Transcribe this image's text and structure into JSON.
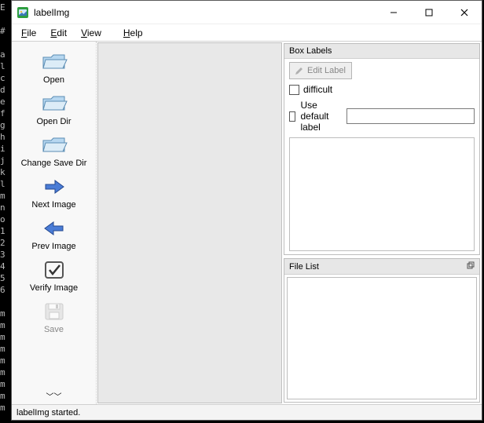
{
  "window": {
    "title": "labelImg"
  },
  "menubar": {
    "file": "File",
    "edit": "Edit",
    "view": "View",
    "help": "Help"
  },
  "toolbar": {
    "open": "Open",
    "open_dir": "Open Dir",
    "change_save_dir": "Change Save Dir",
    "next_image": "Next Image",
    "prev_image": "Prev Image",
    "verify_image": "Verify Image",
    "save": "Save"
  },
  "right": {
    "box_labels": {
      "title": "Box Labels",
      "edit_label": "Edit Label",
      "difficult": "difficult",
      "use_default_label": "Use default label",
      "default_label_value": ""
    },
    "file_list": {
      "title": "File List"
    }
  },
  "statusbar": {
    "message": "labelImg started."
  }
}
